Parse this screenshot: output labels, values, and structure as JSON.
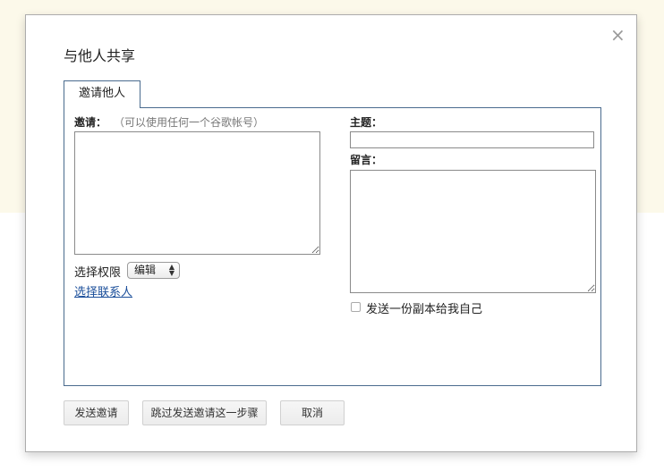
{
  "dialog": {
    "title": "与他人共享",
    "close_icon": "×"
  },
  "tabs": [
    {
      "label": "邀请他人",
      "active": true
    }
  ],
  "invite": {
    "label": "邀请：",
    "hint": "（可以使用任何一个谷歌帐号）",
    "value": ""
  },
  "permission": {
    "label": "选择权限",
    "selected": "编辑"
  },
  "contacts_link": "选择联系人",
  "subject": {
    "label": "主题：",
    "value": ""
  },
  "message": {
    "label": "留言：",
    "value": ""
  },
  "copy_to_self": {
    "label": "发送一份副本给我自己",
    "checked": false
  },
  "buttons": {
    "send": "发送邀请",
    "skip": "跳过发送邀请这一步骤",
    "cancel": "取消"
  },
  "icons": {
    "close": "close-icon",
    "select_arrows": "updown-arrows-icon"
  }
}
